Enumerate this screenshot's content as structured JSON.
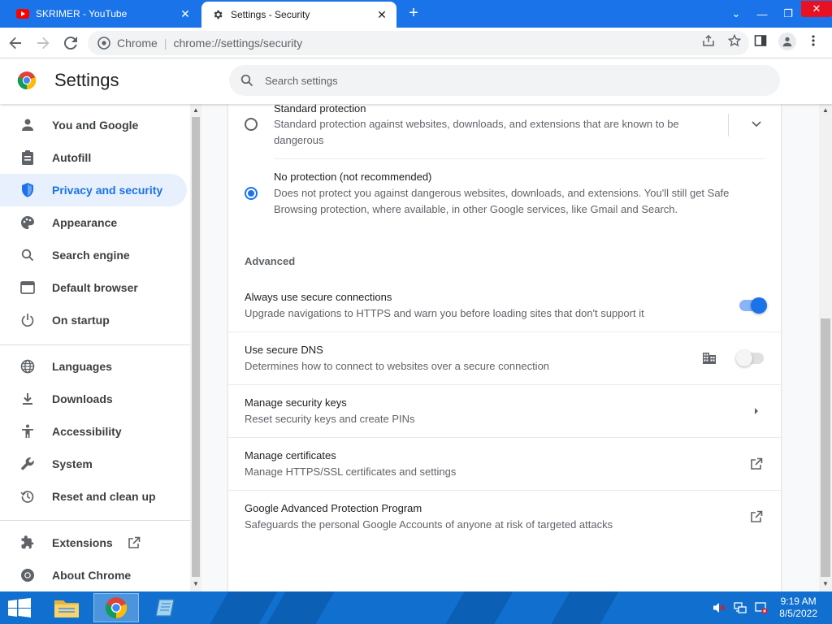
{
  "browser": {
    "tabs": [
      {
        "title": "SKRIMER - YouTube",
        "favicon": "youtube-icon",
        "active": false
      },
      {
        "title": "Settings - Security",
        "favicon": "gear-icon",
        "active": true
      }
    ],
    "omnibox": {
      "site_label": "Chrome",
      "separator": "|",
      "url": "chrome://settings/security"
    }
  },
  "header": {
    "title": "Settings",
    "search_placeholder": "Search settings"
  },
  "sidebar": {
    "items": [
      {
        "label": "You and Google",
        "icon": "person-icon"
      },
      {
        "label": "Autofill",
        "icon": "clipboard-icon"
      },
      {
        "label": "Privacy and security",
        "icon": "shield-icon",
        "selected": true
      },
      {
        "label": "Appearance",
        "icon": "palette-icon"
      },
      {
        "label": "Search engine",
        "icon": "search-icon"
      },
      {
        "label": "Default browser",
        "icon": "browser-window-icon"
      },
      {
        "label": "On startup",
        "icon": "power-icon"
      },
      {
        "label": "Languages",
        "icon": "globe-icon"
      },
      {
        "label": "Downloads",
        "icon": "download-icon"
      },
      {
        "label": "Accessibility",
        "icon": "accessibility-icon"
      },
      {
        "label": "System",
        "icon": "wrench-icon"
      },
      {
        "label": "Reset and clean up",
        "icon": "history-icon"
      },
      {
        "label": "Extensions",
        "icon": "puzzle-icon"
      },
      {
        "label": "About Chrome",
        "icon": "chrome-icon"
      }
    ]
  },
  "security": {
    "standard": {
      "title": "Standard protection",
      "desc": "Standard protection against websites, downloads, and extensions that are known to be dangerous",
      "checked": false
    },
    "no_protection": {
      "title": "No protection (not recommended)",
      "desc": "Does not protect you against dangerous websites, downloads, and extensions. You'll still get Safe Browsing protection, where available, in other Google services, like Gmail and Search.",
      "checked": true
    },
    "advanced_label": "Advanced",
    "rows": [
      {
        "title": "Always use secure connections",
        "desc": "Upgrade navigations to HTTPS and warn you before loading sites that don't support it",
        "control": "toggle",
        "on": true
      },
      {
        "title": "Use secure DNS",
        "desc": "Determines how to connect to websites over a secure connection",
        "control": "toggle",
        "on": false,
        "managed": true
      },
      {
        "title": "Manage security keys",
        "desc": "Reset security keys and create PINs",
        "control": "arrow"
      },
      {
        "title": "Manage certificates",
        "desc": "Manage HTTPS/SSL certificates and settings",
        "control": "external-link"
      },
      {
        "title": "Google Advanced Protection Program",
        "desc": "Safeguards the personal Google Accounts of anyone at risk of targeted attacks",
        "control": "external-link"
      }
    ]
  },
  "taskbar": {
    "time": "9:19 AM",
    "date": "8/5/2022"
  },
  "colors": {
    "accent": "#1a73e8",
    "selected_bg": "#e8f0fe",
    "taskbar": "#1170cf"
  }
}
